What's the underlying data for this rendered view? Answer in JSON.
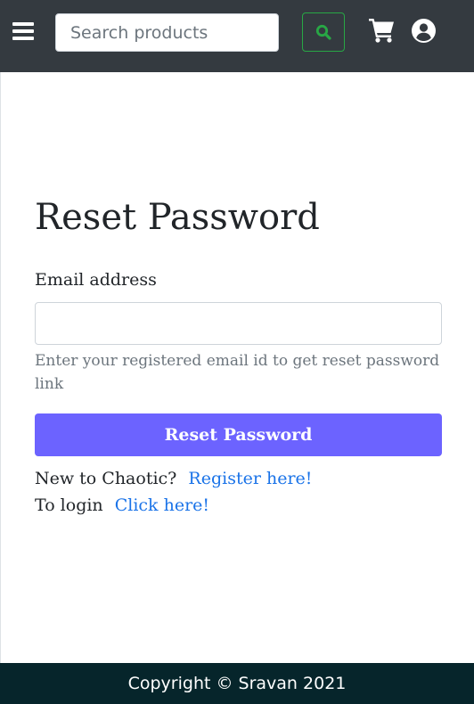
{
  "navbar": {
    "menu_icon": "hamburger-menu-icon",
    "search": {
      "placeholder": "Search products",
      "value": ""
    },
    "search_button_icon": "search-icon",
    "cart_icon": "shopping-cart-icon",
    "user_icon": "user-circle-icon",
    "colors": {
      "background": "#343a40",
      "search_button_border": "#28a745"
    }
  },
  "main": {
    "title": "Reset Password",
    "email_label": "Email address",
    "email_value": "",
    "help_text": "Enter your registered email id to get reset password link",
    "reset_button_label": "Reset Password",
    "register_prompt": "New to Chaotic?",
    "register_link": "Register here!",
    "login_prompt": "To login",
    "login_link": "Click here!",
    "colors": {
      "button": "#6c63ff",
      "link": "#1a73e8"
    }
  },
  "footer": {
    "copyright": "Copyright © Sravan 2021",
    "colors": {
      "background": "#06252b"
    }
  }
}
